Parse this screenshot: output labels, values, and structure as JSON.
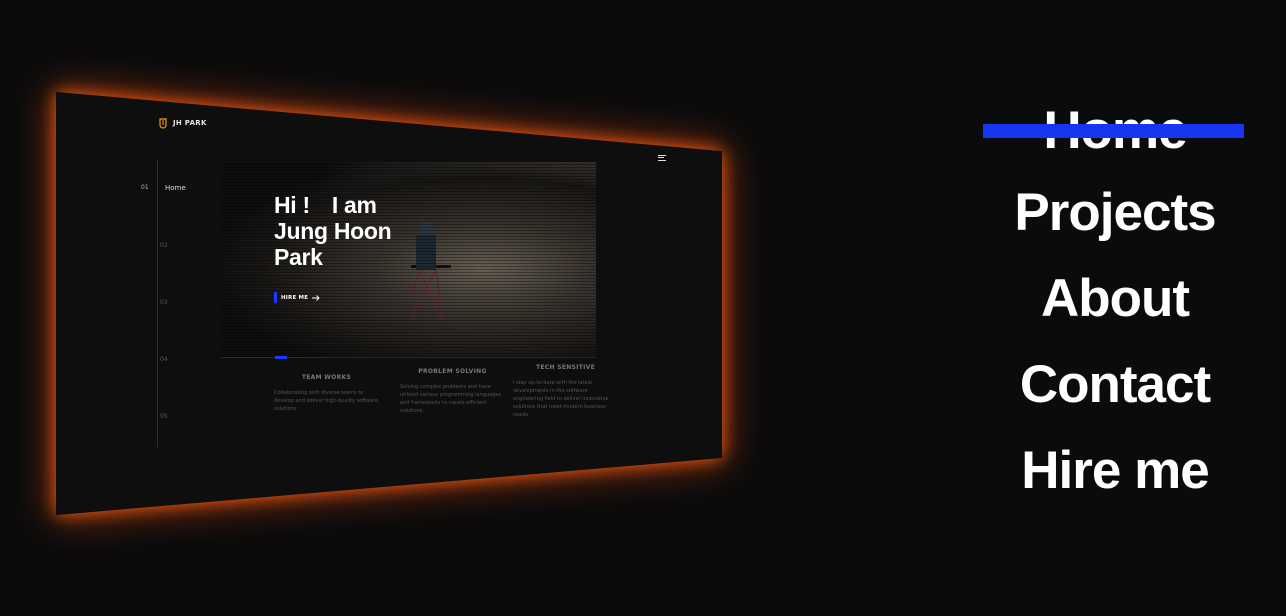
{
  "preview": {
    "logo_text": "JH PARK",
    "nav": {
      "active_num": "01",
      "active_label": "Home",
      "numbers": [
        "02",
        "03",
        "04",
        "05"
      ]
    },
    "hero": {
      "line1a": "Hi !",
      "line1b": "I am",
      "line2": "Jung Hoon",
      "line3": "Park",
      "hire_label": "HIRE ME"
    },
    "features": [
      {
        "title": "TEAM WORKS",
        "text": "Collaborating with diverse teams to develop and deliver high-quality software solutions."
      },
      {
        "title": "PROBLEM SOLVING",
        "text": "Solving complex problems and have utilized various programming languages and frameworks to create efficient solutions."
      },
      {
        "title": "TECH SENSITIVE",
        "text": "I stay up-to-date with the latest developments in the software engineering field to deliver innovative solutions that meet modern business needs."
      }
    ]
  },
  "menu": {
    "items": [
      "Home",
      "Projects",
      "About",
      "Contact",
      "Hire me"
    ],
    "active_index": 0
  },
  "colors": {
    "accent": "#1636f2",
    "glow": "#ea580c",
    "background": "#0b0b0b"
  }
}
